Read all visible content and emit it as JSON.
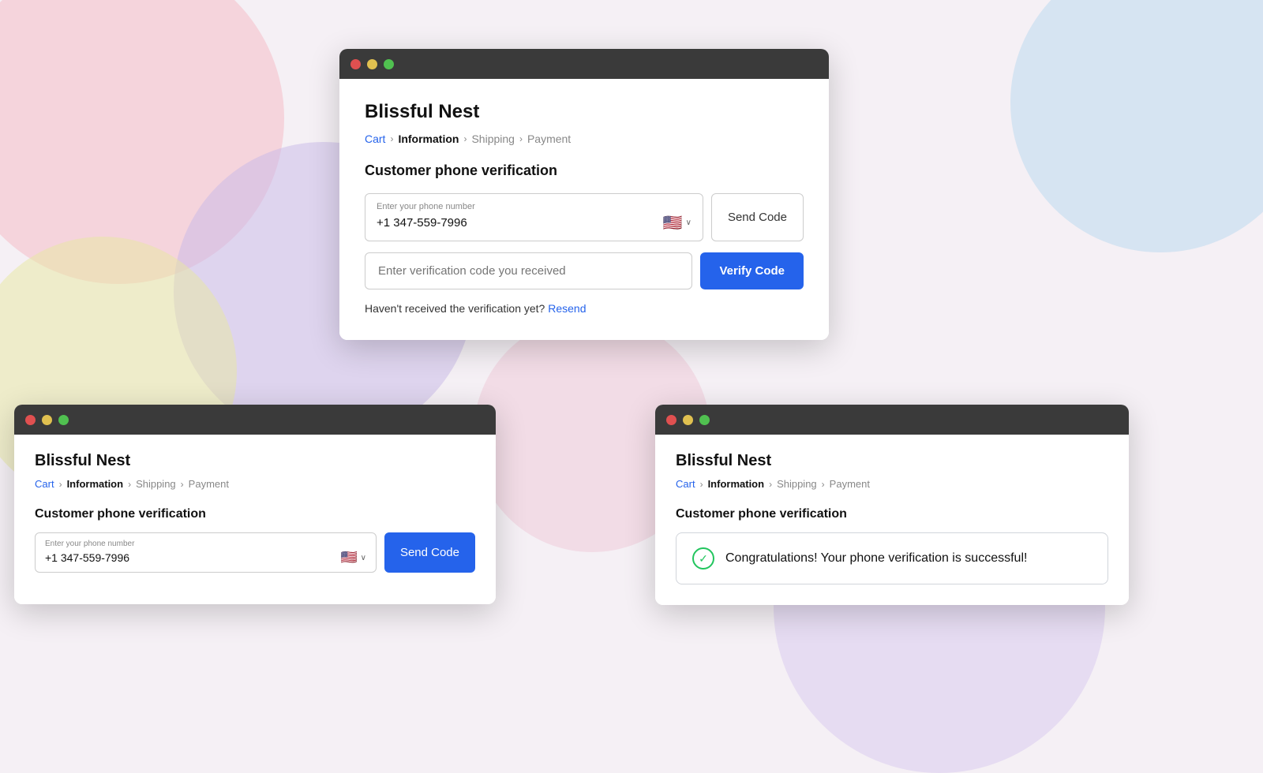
{
  "background": {
    "color": "#f0eaf0"
  },
  "main_window": {
    "title": "Blissful Nest",
    "breadcrumb": {
      "items": [
        {
          "label": "Cart",
          "state": "link"
        },
        {
          "label": "Information",
          "state": "active"
        },
        {
          "label": "Shipping",
          "state": "inactive"
        },
        {
          "label": "Payment",
          "state": "inactive"
        }
      ]
    },
    "section_title": "Customer phone verification",
    "phone_field": {
      "label": "Enter your phone number",
      "value": "+1 347-559-7996",
      "flag": "🇺🇸"
    },
    "send_code_btn": "Send Code",
    "verify_input_placeholder": "Enter verification code you received",
    "verify_btn": "Verify Code",
    "resend_text": "Haven't received the verification yet?",
    "resend_link": "Resend"
  },
  "left_window": {
    "title": "Blissful Nest",
    "breadcrumb": {
      "items": [
        {
          "label": "Cart",
          "state": "link"
        },
        {
          "label": "Information",
          "state": "active"
        },
        {
          "label": "Shipping",
          "state": "inactive"
        },
        {
          "label": "Payment",
          "state": "inactive"
        }
      ]
    },
    "section_title": "Customer phone verification",
    "phone_field": {
      "label": "Enter your phone number",
      "value": "+1 347-559-7996",
      "flag": "🇺🇸"
    },
    "send_code_btn": "Send Code"
  },
  "right_window": {
    "title": "Blissful Nest",
    "breadcrumb": {
      "items": [
        {
          "label": "Cart",
          "state": "link"
        },
        {
          "label": "Information",
          "state": "active"
        },
        {
          "label": "Shipping",
          "state": "inactive"
        },
        {
          "label": "Payment",
          "state": "inactive"
        }
      ]
    },
    "section_title": "Customer phone verification",
    "success_message": "Congratulations! Your phone verification is successful!"
  },
  "icons": {
    "close": "●",
    "minimize": "●",
    "maximize": "●",
    "chevron_right": "›",
    "chevron_down": "∨",
    "check": "✓"
  }
}
